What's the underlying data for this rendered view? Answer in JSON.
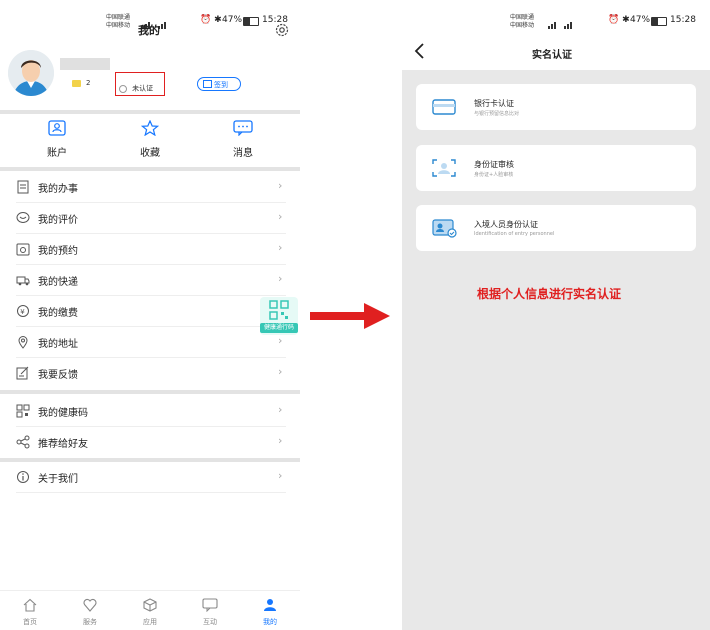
{
  "left": {
    "status": {
      "carrier1": "中国联通",
      "carrier2": "中国移动",
      "battery": "47%",
      "time": "15:28"
    },
    "title": "我的",
    "profile": {
      "points": "2",
      "verify_label": "未认证",
      "checkin_label": "签到"
    },
    "quick": [
      {
        "label": "账户",
        "icon": "account-icon"
      },
      {
        "label": "收藏",
        "icon": "star-icon"
      },
      {
        "label": "消息",
        "icon": "message-icon"
      }
    ],
    "menu": [
      {
        "label": "我的办事",
        "icon": "document-icon"
      },
      {
        "label": "我的评价",
        "icon": "comment-icon"
      },
      {
        "label": "我的预约",
        "icon": "calendar-icon"
      },
      {
        "label": "我的快递",
        "icon": "truck-icon"
      },
      {
        "label": "我的缴费",
        "icon": "payment-icon"
      },
      {
        "label": "我的地址",
        "icon": "location-icon"
      },
      {
        "label": "我要反馈",
        "icon": "feedback-icon"
      },
      {
        "label": "我的健康码",
        "icon": "qrcode-icon"
      },
      {
        "label": "推荐给好友",
        "icon": "share-icon"
      },
      {
        "label": "关于我们",
        "icon": "info-icon"
      }
    ],
    "health_badge": "健康通行码",
    "tabs": [
      {
        "label": "首页",
        "icon": "home-icon"
      },
      {
        "label": "服务",
        "icon": "service-icon"
      },
      {
        "label": "应用",
        "icon": "apps-icon"
      },
      {
        "label": "互动",
        "icon": "chat-icon"
      },
      {
        "label": "我的",
        "icon": "user-icon",
        "active": true
      }
    ]
  },
  "right": {
    "status": {
      "carrier1": "中国联通",
      "carrier2": "中国移动",
      "battery": "47%",
      "time": "15:28"
    },
    "title": "实名认证",
    "cards": [
      {
        "title": "银行卡认证",
        "subtitle": "与银行预留信息比对",
        "icon": "bank-card-icon"
      },
      {
        "title": "身份证审核",
        "subtitle": "身份证+人脸审核",
        "icon": "id-scan-icon"
      },
      {
        "title": "入境人员身份认证",
        "subtitle": "Identification of entry personnel",
        "icon": "entry-id-icon"
      }
    ],
    "annotation": "根据个人信息进行实名认证"
  },
  "colors": {
    "accent": "#1677ff",
    "red": "#e02020",
    "teal": "#36c7b5"
  }
}
